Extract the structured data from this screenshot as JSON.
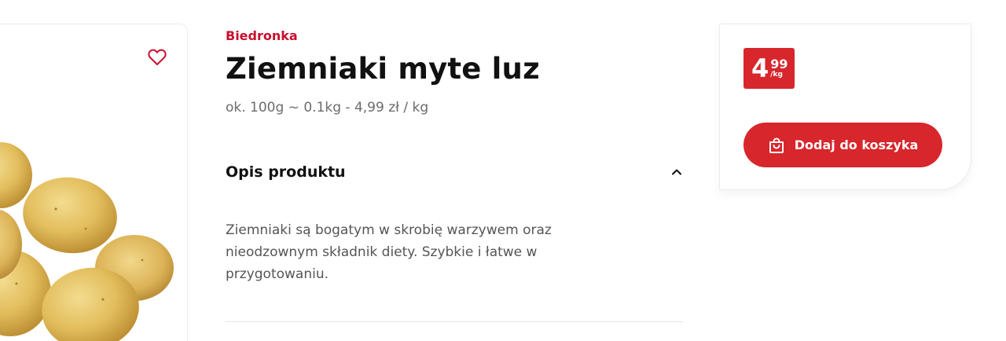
{
  "product": {
    "brand": "Biedronka",
    "title": "Ziemniaki myte luz",
    "subtitle": "ok. 100g ~ 0.1kg - 4,99 zł / kg",
    "image_alt": "potatoes"
  },
  "description": {
    "header": "Opis produktu",
    "body": "Ziemniaki są bogatym w skrobię warzywem oraz nieodzownym składnik diety. Szybkie i łatwe w przygotowaniu.",
    "expanded": true
  },
  "price": {
    "integer": "4",
    "decimal": "99",
    "unit": "/kg"
  },
  "cart": {
    "add_label": "Dodaj do koszyka"
  },
  "colors": {
    "brand": "#c8102e",
    "accent": "#d7262c",
    "text_muted": "#6b6b6b"
  }
}
